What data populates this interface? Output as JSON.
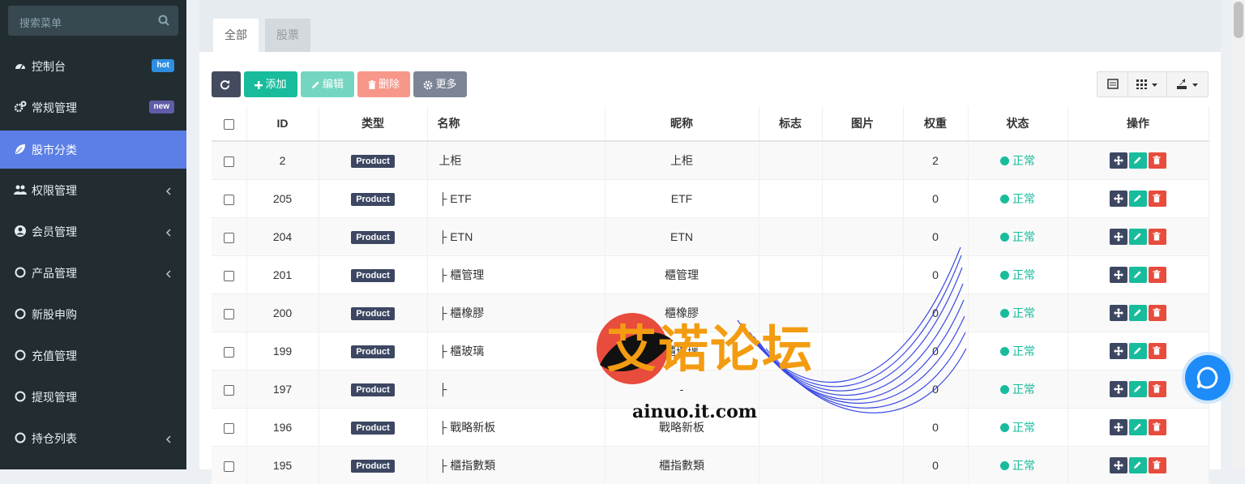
{
  "sidebar": {
    "search_placeholder": "搜索菜单",
    "items": [
      {
        "label": "控制台",
        "badge": "hot",
        "icon": "dashboard-icon"
      },
      {
        "label": "常规管理",
        "badge": "new",
        "icon": "cogs-icon"
      },
      {
        "label": "股市分类",
        "icon": "leaf-icon",
        "active": true
      },
      {
        "label": "权限管理",
        "icon": "users-icon"
      },
      {
        "label": "会员管理",
        "icon": "user-circle-icon"
      },
      {
        "label": "产品管理",
        "icon": "circle-icon"
      },
      {
        "label": "新股申购",
        "icon": "circle-icon"
      },
      {
        "label": "充值管理",
        "icon": "circle-icon"
      },
      {
        "label": "提现管理",
        "icon": "circle-icon"
      },
      {
        "label": "持仓列表",
        "icon": "circle-icon"
      }
    ]
  },
  "tabs": [
    {
      "label": "全部"
    },
    {
      "label": "股票"
    }
  ],
  "toolbar": {
    "add": "添加",
    "edit": "编辑",
    "delete": "删除",
    "more": "更多"
  },
  "table": {
    "headers": {
      "id": "ID",
      "type": "类型",
      "name": "名称",
      "nickname": "昵称",
      "flag": "标志",
      "image": "图片",
      "weight": "权重",
      "status": "状态",
      "ops": "操作"
    },
    "rows": [
      {
        "id": "2",
        "type": "Product",
        "name": "上柜",
        "nickname": "上柜",
        "weight": "2",
        "status": "正常"
      },
      {
        "id": "205",
        "type": "Product",
        "name": "├ ETF",
        "nickname": "ETF",
        "weight": "0",
        "status": "正常"
      },
      {
        "id": "204",
        "type": "Product",
        "name": "├ ETN",
        "nickname": "ETN",
        "weight": "0",
        "status": "正常"
      },
      {
        "id": "201",
        "type": "Product",
        "name": "├ 櫃管理",
        "nickname": "櫃管理",
        "weight": "0",
        "status": "正常"
      },
      {
        "id": "200",
        "type": "Product",
        "name": "├ 櫃橡膠",
        "nickname": "櫃橡膠",
        "weight": "0",
        "status": "正常"
      },
      {
        "id": "199",
        "type": "Product",
        "name": "├ 櫃玻璃",
        "nickname": "櫃玻璃",
        "weight": "0",
        "status": "正常"
      },
      {
        "id": "197",
        "type": "Product",
        "name": "├",
        "nickname": "-",
        "weight": "0",
        "status": "正常"
      },
      {
        "id": "196",
        "type": "Product",
        "name": "├ 戰略新板",
        "nickname": "戰略新板",
        "weight": "0",
        "status": "正常"
      },
      {
        "id": "195",
        "type": "Product",
        "name": "├ 櫃指數類",
        "nickname": "櫃指數類",
        "weight": "0",
        "status": "正常"
      }
    ]
  },
  "watermark": {
    "text": "艾诺论坛",
    "url": "ainuo.it.com"
  },
  "colors": {
    "sidebar": "#222d32",
    "active": "#5b7fe6",
    "success": "#18bc9c",
    "danger": "#e74c3c",
    "primary_dark": "#3d4762"
  }
}
